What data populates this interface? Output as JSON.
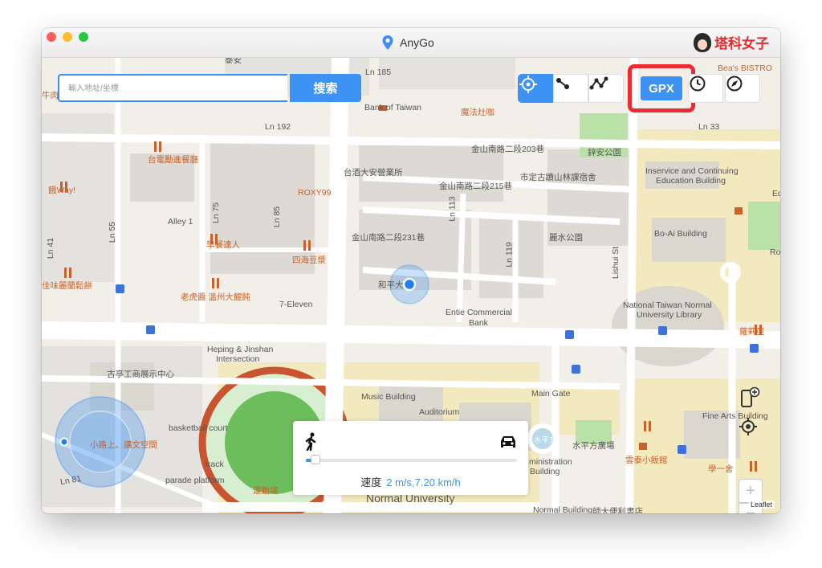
{
  "app": {
    "title": "AnyGo",
    "brand": "塔科女子"
  },
  "search": {
    "placeholder": "輸入地址/坐標",
    "button": "搜索"
  },
  "toolbar": {
    "items": [
      {
        "name": "teleport-mode",
        "icon": "crosshair-icon",
        "active": true
      },
      {
        "name": "two-spot-mode",
        "icon": "two-spot-route-icon",
        "active": false
      },
      {
        "name": "multi-spot-mode",
        "icon": "multi-spot-route-icon",
        "active": false
      }
    ],
    "gpx_label": "GPX",
    "history_icon": "clock-icon",
    "joystick_icon": "compass-icon"
  },
  "speed": {
    "label": "速度",
    "value": "2 m/s,7.20 km/h",
    "slider_fraction": 0.03
  },
  "map": {
    "labels": [
      "Ln 185",
      "Bank of Taiwan",
      "魔法灶咖",
      "Ln 192",
      "Ln 33",
      "台電勵進餐廳",
      "金山南路二段203巷",
      "鋅安公園",
      "台酒大安營業所",
      "市定古蹟山林課宿舍",
      "Inservice and Continuing",
      "Education Building",
      "Ln 75",
      "Ln 85",
      "ROXY99",
      "金山南路二段215巷",
      "餓Way!",
      "Alley 1",
      "Ln 113",
      "Ln 55",
      "Ln 41",
      "早餐達人",
      "金山南路二段231巷",
      "麗水公園",
      "Bo-Ai Building",
      "四海豆漿",
      "Ln 119",
      "Lishui St",
      "佳味麗蘭鬆餅",
      "老虎醬 溫州大餛飩",
      "和平大",
      "7-Eleven",
      "Entie Commercial",
      "Bank",
      "National Taiwan Normal",
      "University Library",
      "蘿莉亞",
      "Heping & Jinshan",
      "Intersection",
      "古亭工商展示中心",
      "Music Building",
      "Main Gate",
      "Auditorium",
      "水平方",
      "水平方廣場",
      "Fine Arts Building",
      "basketball court",
      "小路上。講文空間",
      "雲泰小飯館",
      "track",
      "學一舍",
      "parade platform",
      "Ln 81",
      "運動場",
      "ministration",
      "Building",
      "Normal University",
      "Normal Building",
      "師大便利書店",
      "泰安",
      "牛肉",
      "Bea's BISTRO",
      "Ed",
      "Ro"
    ],
    "attribution": "Leaflet"
  },
  "zoom": {
    "in_label": "+",
    "out_label": "−"
  },
  "colors": {
    "accent": "#3d92f3",
    "highlight": "#ee2a32",
    "poi": "#c8622a"
  }
}
